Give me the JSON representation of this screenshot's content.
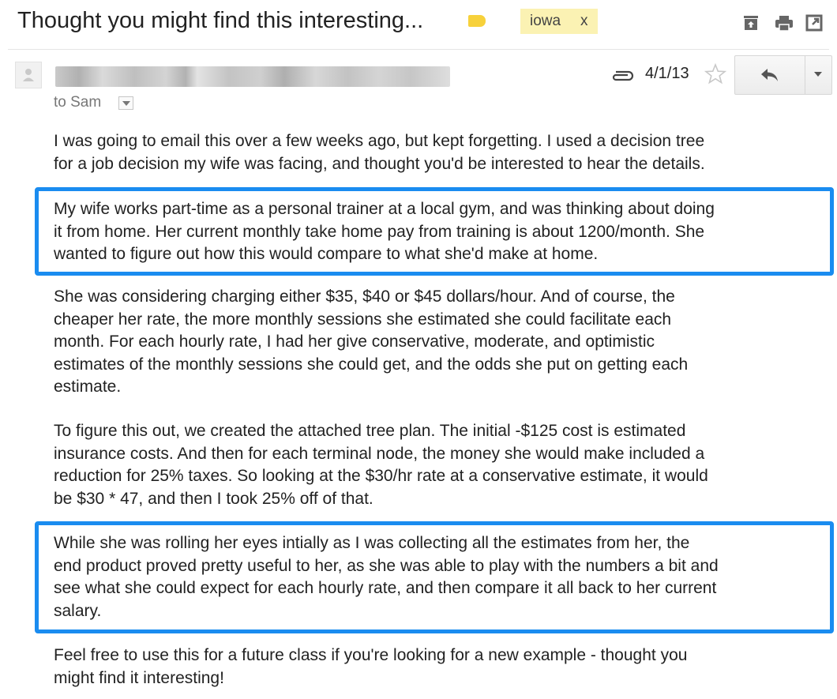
{
  "subject": "Thought you might find this interesting...",
  "label": {
    "name": "iowa",
    "remove": "x",
    "tag_color": "#f7d13b",
    "chip_color": "#fbf2b3"
  },
  "toolbar_icons": [
    "archive-icon",
    "print-icon",
    "new-window-icon"
  ],
  "message": {
    "recipient": "to Sam",
    "date": "4/1/13",
    "has_attachment": true
  },
  "highlight_color": "#1a8cf0",
  "body": [
    "I was going to email this over a few weeks ago, but kept forgetting.  I used a decision tree\nfor a job decision my wife was facing, and thought you'd be interested to hear the details.",
    "My wife works part-time as a personal trainer at a local gym, and was thinking about doing\nit from home.  Her current monthly take home pay from training is about 1200/month.  She\nwanted to figure out how this would compare to what she'd make at home.",
    "She was considering charging either $35, $40 or $45 dollars/hour.  And of course, the\ncheaper her rate, the more monthly sessions she estimated she could facilitate each\nmonth.  For each hourly rate, I had her give conservative, moderate, and optimistic\nestimates of the monthly sessions she could get, and the odds she put on getting each\nestimate.",
    "To figure this out, we created the attached tree plan.  The initial -$125 cost is estimated\ninsurance costs.  And then for each terminal node, the money she would make included a\nreduction for 25% taxes.  So looking at the $30/hr rate at a conservative estimate, it would\nbe $30 * 47, and then I took 25% off of that.",
    "While she was rolling her eyes intially as I was collecting all the estimates from her, the\nend product proved pretty useful to her, as she was able to play with the numbers a bit and\nsee what she could expect for each hourly rate, and then compare it all back to her current\nsalary.",
    "Feel free to use this for a future class if you're looking for a new example - thought you\nmight find it interesting!"
  ]
}
